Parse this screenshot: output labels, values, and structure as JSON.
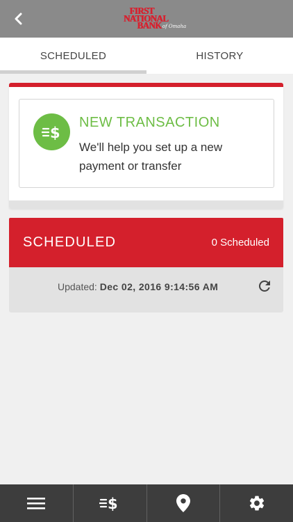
{
  "header": {
    "logo_lines": [
      "FIRST",
      "NATIONAL",
      "BANK"
    ],
    "logo_script": "of Omaha",
    "back_icon": "chevron-left-icon"
  },
  "tabs": [
    {
      "label": "SCHEDULED",
      "active": true
    },
    {
      "label": "HISTORY",
      "active": false
    }
  ],
  "new_transaction": {
    "icon": "transfer-dollar-icon",
    "title": "NEW TRANSACTION",
    "description": "We'll help you set up a new payment or transfer"
  },
  "scheduled": {
    "title": "SCHEDULED",
    "count": "0 Scheduled",
    "updated_label": "Updated:",
    "updated_value": "Dec 02, 2016 9:14:56 AM",
    "refresh_icon": "refresh-icon"
  },
  "bottom_nav": [
    {
      "icon": "menu-icon"
    },
    {
      "icon": "transfer-dollar-icon"
    },
    {
      "icon": "location-pin-icon"
    },
    {
      "icon": "gear-icon"
    }
  ],
  "colors": {
    "brand_red": "#d4202c",
    "accent_green": "#6dbd45",
    "header_gray": "#8a8a8a",
    "nav_dark": "#3d3d3d"
  }
}
